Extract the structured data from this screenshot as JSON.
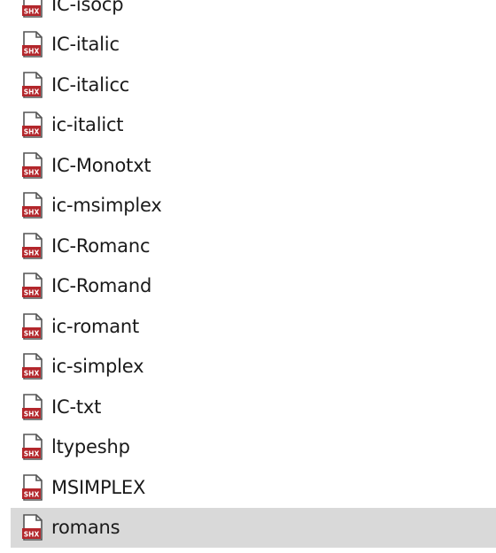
{
  "files": [
    {
      "name": "IC-isocp",
      "icon": "shx-file-icon",
      "icon_badge": "SHX",
      "selected": false
    },
    {
      "name": "IC-italic",
      "icon": "shx-file-icon",
      "icon_badge": "SHX",
      "selected": false
    },
    {
      "name": "IC-italicc",
      "icon": "shx-file-icon",
      "icon_badge": "SHX",
      "selected": false
    },
    {
      "name": "ic-italict",
      "icon": "shx-file-icon",
      "icon_badge": "SHX",
      "selected": false
    },
    {
      "name": "IC-Monotxt",
      "icon": "shx-file-icon",
      "icon_badge": "SHX",
      "selected": false
    },
    {
      "name": "ic-msimplex",
      "icon": "shx-file-icon",
      "icon_badge": "SHX",
      "selected": false
    },
    {
      "name": "IC-Romanc",
      "icon": "shx-file-icon",
      "icon_badge": "SHX",
      "selected": false
    },
    {
      "name": "IC-Romand",
      "icon": "shx-file-icon",
      "icon_badge": "SHX",
      "selected": false
    },
    {
      "name": "ic-romant",
      "icon": "shx-file-icon",
      "icon_badge": "SHX",
      "selected": false
    },
    {
      "name": "ic-simplex",
      "icon": "shx-file-icon",
      "icon_badge": "SHX",
      "selected": false
    },
    {
      "name": "IC-txt",
      "icon": "shx-file-icon",
      "icon_badge": "SHX",
      "selected": false
    },
    {
      "name": "ltypeshp",
      "icon": "shx-file-icon",
      "icon_badge": "SHX",
      "selected": false
    },
    {
      "name": "MSIMPLEX",
      "icon": "shx-file-icon",
      "icon_badge": "SHX",
      "selected": false
    },
    {
      "name": "romans",
      "icon": "shx-file-icon",
      "icon_badge": "SHX",
      "selected": true
    }
  ],
  "colors": {
    "selection_background": "#d9d9d9",
    "icon_badge": "#b3262b",
    "icon_page": "#ffffff",
    "icon_outline": "#555555",
    "text": "#1a1a1a"
  }
}
